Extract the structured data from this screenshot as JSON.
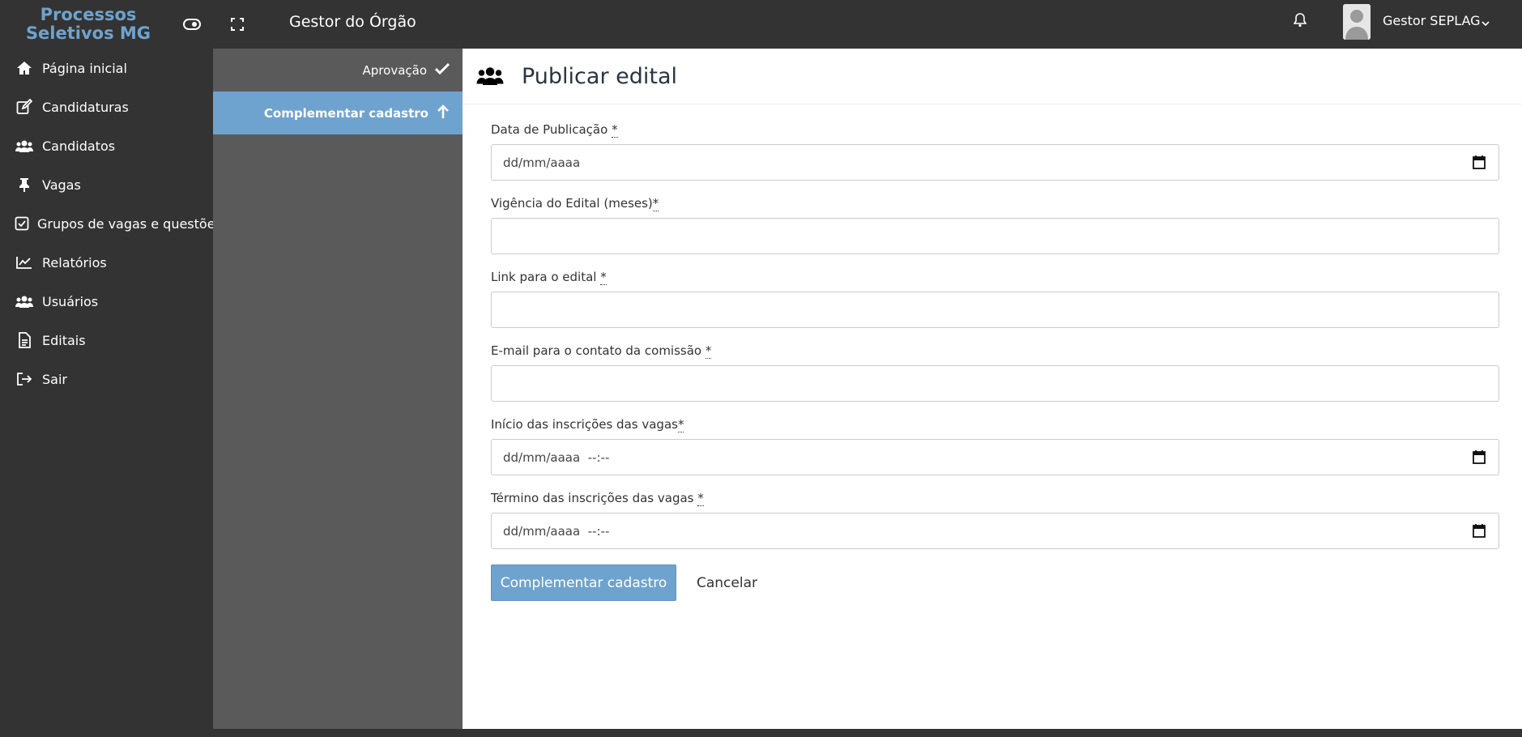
{
  "header": {
    "brand_line1": "Processos",
    "brand_line2": "Seletivos MG",
    "org_title": "Gestor do Órgão",
    "user_name": "Gestor SEPLAG"
  },
  "sidebar": {
    "items": [
      {
        "label": "Página inicial",
        "icon": "home-icon"
      },
      {
        "label": "Candidaturas",
        "icon": "edit-icon"
      },
      {
        "label": "Candidatos",
        "icon": "users-icon"
      },
      {
        "label": "Vagas",
        "icon": "pin-icon"
      },
      {
        "label": "Grupos de vagas e questões",
        "icon": "checkbox-icon"
      },
      {
        "label": "Relatórios",
        "icon": "chart-icon"
      },
      {
        "label": "Usuários",
        "icon": "users-icon"
      },
      {
        "label": "Editais",
        "icon": "document-icon"
      },
      {
        "label": "Sair",
        "icon": "sign-out-icon"
      }
    ]
  },
  "steps": [
    {
      "label": "Aprovação",
      "icon": "check-icon"
    },
    {
      "label": "Complementar cadastro",
      "icon": "arrow-up-icon",
      "active": true
    }
  ],
  "main": {
    "title": "Publicar edital",
    "title_icon": "users-icon",
    "fields": [
      {
        "label": "Data de Publicação ",
        "required": "*",
        "placeholder": "dd/mm/aaaa",
        "type": "date"
      },
      {
        "label": "Vigência do Edital (meses)",
        "required": "*",
        "placeholder": "",
        "type": "number"
      },
      {
        "label": "Link para o edital ",
        "required": "*",
        "placeholder": "",
        "type": "text"
      },
      {
        "label": "E-mail para o contato da comissão ",
        "required": "*",
        "placeholder": "",
        "type": "email"
      },
      {
        "label": "Início das inscrições das vagas",
        "required": "*",
        "placeholder": "dd/mm/aaaa  --:--",
        "type": "datetime"
      },
      {
        "label": "Término das inscrições das vagas ",
        "required": "*",
        "placeholder": "dd/mm/aaaa  --:--",
        "type": "datetime"
      }
    ],
    "submit_label": "Complementar cadastro",
    "cancel_label": "Cancelar"
  },
  "colors": {
    "topbar": "#333333",
    "sidebar": "#333333",
    "steps_panel": "#5a5a5a",
    "accent": "#6fa3cf"
  }
}
